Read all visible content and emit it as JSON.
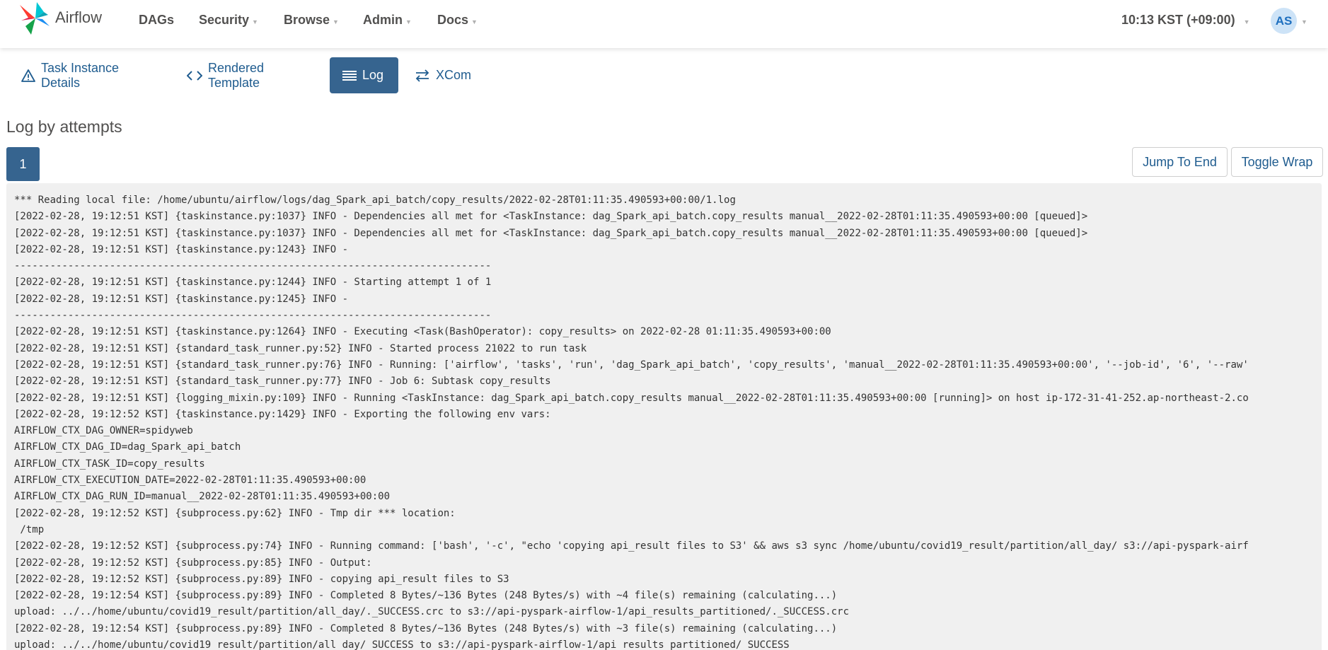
{
  "brand": {
    "name": "Airflow"
  },
  "nav": [
    {
      "label": "DAGs",
      "caret": false
    },
    {
      "label": "Security",
      "caret": true
    },
    {
      "label": "Browse",
      "caret": true
    },
    {
      "label": "Admin",
      "caret": true
    },
    {
      "label": "Docs",
      "caret": true
    }
  ],
  "clock": {
    "label": "10:13 KST (+09:00)"
  },
  "user": {
    "initials": "AS"
  },
  "tabs": [
    {
      "label": "Task Instance Details",
      "icon": "warning-triangle-icon",
      "active": false
    },
    {
      "label": "Rendered Template",
      "icon": "code-brackets-icon",
      "active": false
    },
    {
      "label": "Log",
      "icon": "list-icon",
      "active": true
    },
    {
      "label": "XCom",
      "icon": "exchange-arrows-icon",
      "active": false
    }
  ],
  "log_section": {
    "title": "Log by attempts",
    "attempt": "1",
    "jump_to_end": "Jump To End",
    "toggle_wrap": "Toggle Wrap"
  },
  "colors": {
    "primary": "#36648f",
    "link": "#1f5c8f",
    "log_bg": "#f0f0f0"
  },
  "log_lines": [
    "*** Reading local file: /home/ubuntu/airflow/logs/dag_Spark_api_batch/copy_results/2022-02-28T01:11:35.490593+00:00/1.log",
    "[2022-02-28, 19:12:51 KST] {taskinstance.py:1037} INFO - Dependencies all met for <TaskInstance: dag_Spark_api_batch.copy_results manual__2022-02-28T01:11:35.490593+00:00 [queued]>",
    "[2022-02-28, 19:12:51 KST] {taskinstance.py:1037} INFO - Dependencies all met for <TaskInstance: dag_Spark_api_batch.copy_results manual__2022-02-28T01:11:35.490593+00:00 [queued]>",
    "[2022-02-28, 19:12:51 KST] {taskinstance.py:1243} INFO -",
    "--------------------------------------------------------------------------------",
    "[2022-02-28, 19:12:51 KST] {taskinstance.py:1244} INFO - Starting attempt 1 of 1",
    "[2022-02-28, 19:12:51 KST] {taskinstance.py:1245} INFO -",
    "--------------------------------------------------------------------------------",
    "[2022-02-28, 19:12:51 KST] {taskinstance.py:1264} INFO - Executing <Task(BashOperator): copy_results> on 2022-02-28 01:11:35.490593+00:00",
    "[2022-02-28, 19:12:51 KST] {standard_task_runner.py:52} INFO - Started process 21022 to run task",
    "[2022-02-28, 19:12:51 KST] {standard_task_runner.py:76} INFO - Running: ['airflow', 'tasks', 'run', 'dag_Spark_api_batch', 'copy_results', 'manual__2022-02-28T01:11:35.490593+00:00', '--job-id', '6', '--raw'",
    "[2022-02-28, 19:12:51 KST] {standard_task_runner.py:77} INFO - Job 6: Subtask copy_results",
    "[2022-02-28, 19:12:51 KST] {logging_mixin.py:109} INFO - Running <TaskInstance: dag_Spark_api_batch.copy_results manual__2022-02-28T01:11:35.490593+00:00 [running]> on host ip-172-31-41-252.ap-northeast-2.co",
    "[2022-02-28, 19:12:52 KST] {taskinstance.py:1429} INFO - Exporting the following env vars:",
    "AIRFLOW_CTX_DAG_OWNER=spidyweb",
    "AIRFLOW_CTX_DAG_ID=dag_Spark_api_batch",
    "AIRFLOW_CTX_TASK_ID=copy_results",
    "AIRFLOW_CTX_EXECUTION_DATE=2022-02-28T01:11:35.490593+00:00",
    "AIRFLOW_CTX_DAG_RUN_ID=manual__2022-02-28T01:11:35.490593+00:00",
    "[2022-02-28, 19:12:52 KST] {subprocess.py:62} INFO - Tmp dir *** location:",
    " /tmp",
    "[2022-02-28, 19:12:52 KST] {subprocess.py:74} INFO - Running command: ['bash', '-c', \"echo 'copying api_result files to S3' && aws s3 sync /home/ubuntu/covid19_result/partition/all_day/ s3://api-pyspark-airf",
    "[2022-02-28, 19:12:52 KST] {subprocess.py:85} INFO - Output:",
    "[2022-02-28, 19:12:52 KST] {subprocess.py:89} INFO - copying api_result files to S3",
    "[2022-02-28, 19:12:54 KST] {subprocess.py:89} INFO - Completed 8 Bytes/~136 Bytes (248 Bytes/s) with ~4 file(s) remaining (calculating...)",
    "upload: ../../home/ubuntu/covid19_result/partition/all_day/._SUCCESS.crc to s3://api-pyspark-airflow-1/api_results_partitioned/._SUCCESS.crc",
    "[2022-02-28, 19:12:54 KST] {subprocess.py:89} INFO - Completed 8 Bytes/~136 Bytes (248 Bytes/s) with ~3 file(s) remaining (calculating...)",
    "upload: ../../home/ubuntu/covid19_result/partition/all_day/_SUCCESS to s3://api-pyspark-airflow-1/api_results_partitioned/_SUCCESS"
  ]
}
